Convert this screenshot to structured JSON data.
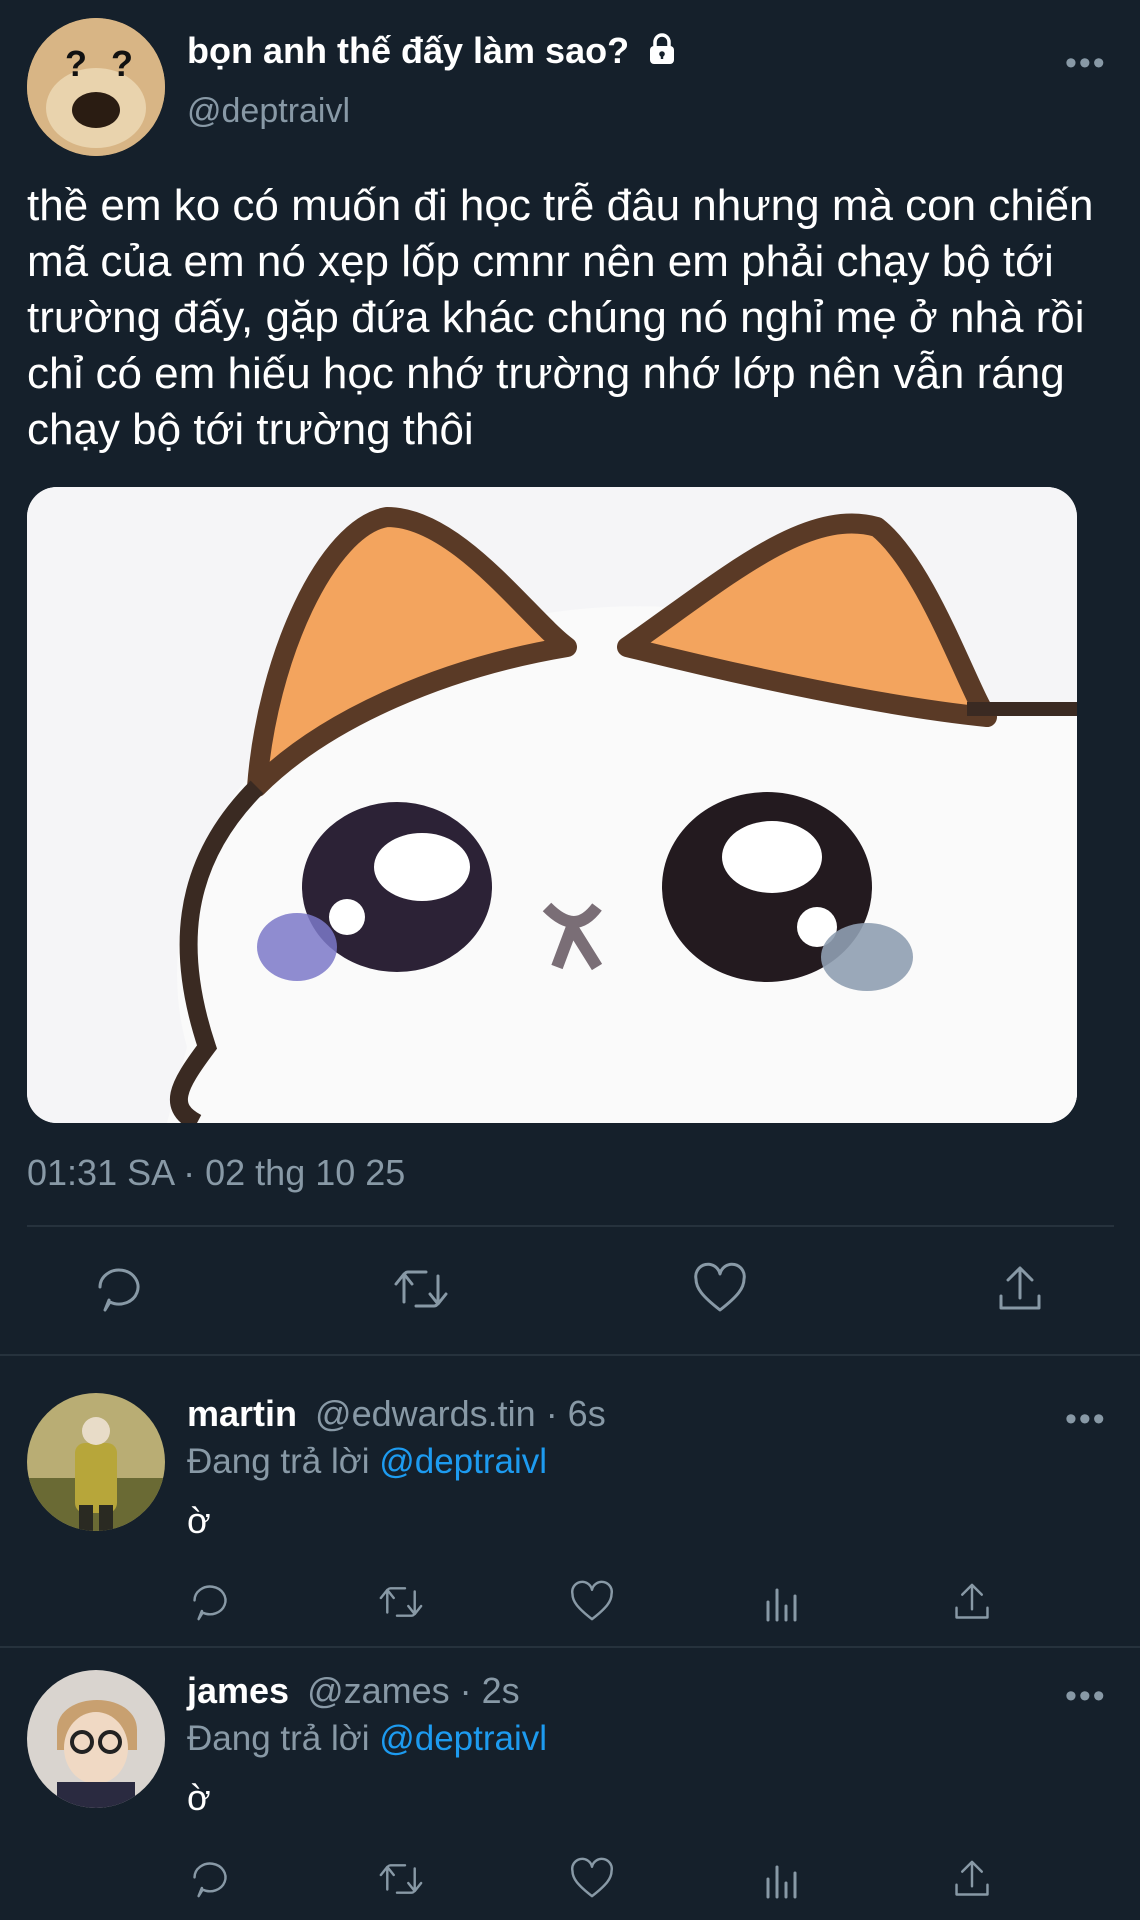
{
  "tweet": {
    "display_name": "bọn anh thế đấy làm sao?",
    "handle": "@deptraivl",
    "text": "thề em ko có muốn đi học trễ đâu nhưng mà con chiến mã của em nó xẹp lốp cmnr nên em phải chạy bộ tới trường đấy, gặp đứa khác chúng nó nghỉ mẹ ở nhà rồi chỉ có em hiếu học nhớ trường nhớ lớp nên vẫn ráng chạy bộ tới trường thôi",
    "timestamp": "01:31 SA · 02 thg 10 25",
    "avatar_emoji": "? ?"
  },
  "replies": [
    {
      "display_name": "martin",
      "meta": "@edwards.tin · 6s",
      "replying_prefix": "Đang trả lời",
      "replying_to": "@deptraivl",
      "text": "ờ"
    },
    {
      "display_name": "james",
      "meta": "@zames · 2s",
      "replying_prefix": "Đang trả lời",
      "replying_to": "@deptraivl",
      "text": "ờ"
    }
  ],
  "icons": {
    "more": "more-icon",
    "lock": "lock-icon",
    "reply": "reply-icon",
    "retweet": "retweet-icon",
    "like": "heart-icon",
    "share": "share-icon",
    "views": "views-icon"
  },
  "colors": {
    "background": "#15202b",
    "muted": "#8899a6",
    "link": "#1d9bf0",
    "divider": "#26323d"
  },
  "more_label": "•••"
}
